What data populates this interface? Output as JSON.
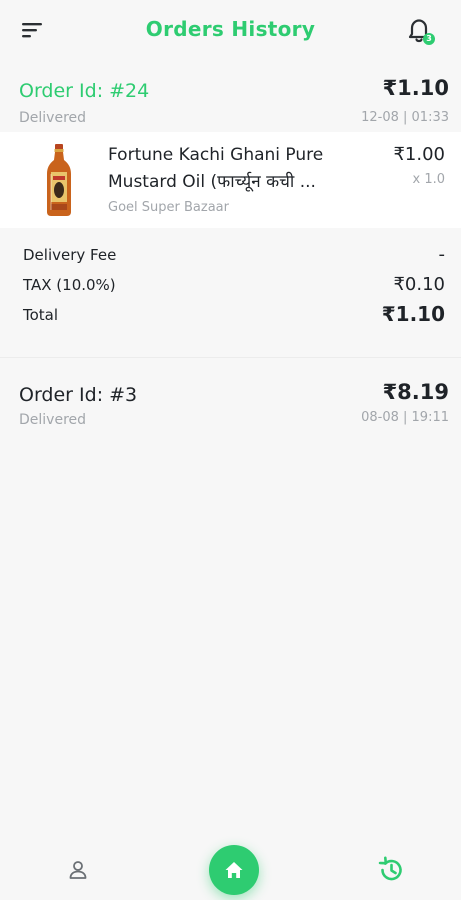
{
  "header": {
    "title": "Orders History",
    "notification_count": "3"
  },
  "orders": [
    {
      "id_label": "Order Id: #24",
      "status": "Delivered",
      "amount": "₹1.10",
      "date": "12-08 | 01:33",
      "items": [
        {
          "name_line1": "Fortune Kachi Ghani Pure",
          "name_line2": "Mustard Oil (फार्च्यून कची ...",
          "store": "Goel Super Bazaar",
          "price": "₹1.00",
          "qty": "x 1.0"
        }
      ],
      "summary": {
        "delivery_fee_label": "Delivery Fee",
        "delivery_fee_value": "-",
        "tax_label": "TAX (10.0%)",
        "tax_value": "₹0.10",
        "total_label": "Total",
        "total_value": "₹1.10"
      }
    },
    {
      "id_label": "Order Id: #3",
      "status": "Delivered",
      "amount": "₹8.19",
      "date": "08-08 | 19:11"
    }
  ],
  "colors": {
    "accent": "#2ecc71",
    "text": "#1f2328",
    "muted": "#a2a6ab",
    "background": "#f7f7f7"
  },
  "icons": [
    "menu-icon",
    "bell-icon",
    "profile-icon",
    "home-icon",
    "history-icon"
  ]
}
